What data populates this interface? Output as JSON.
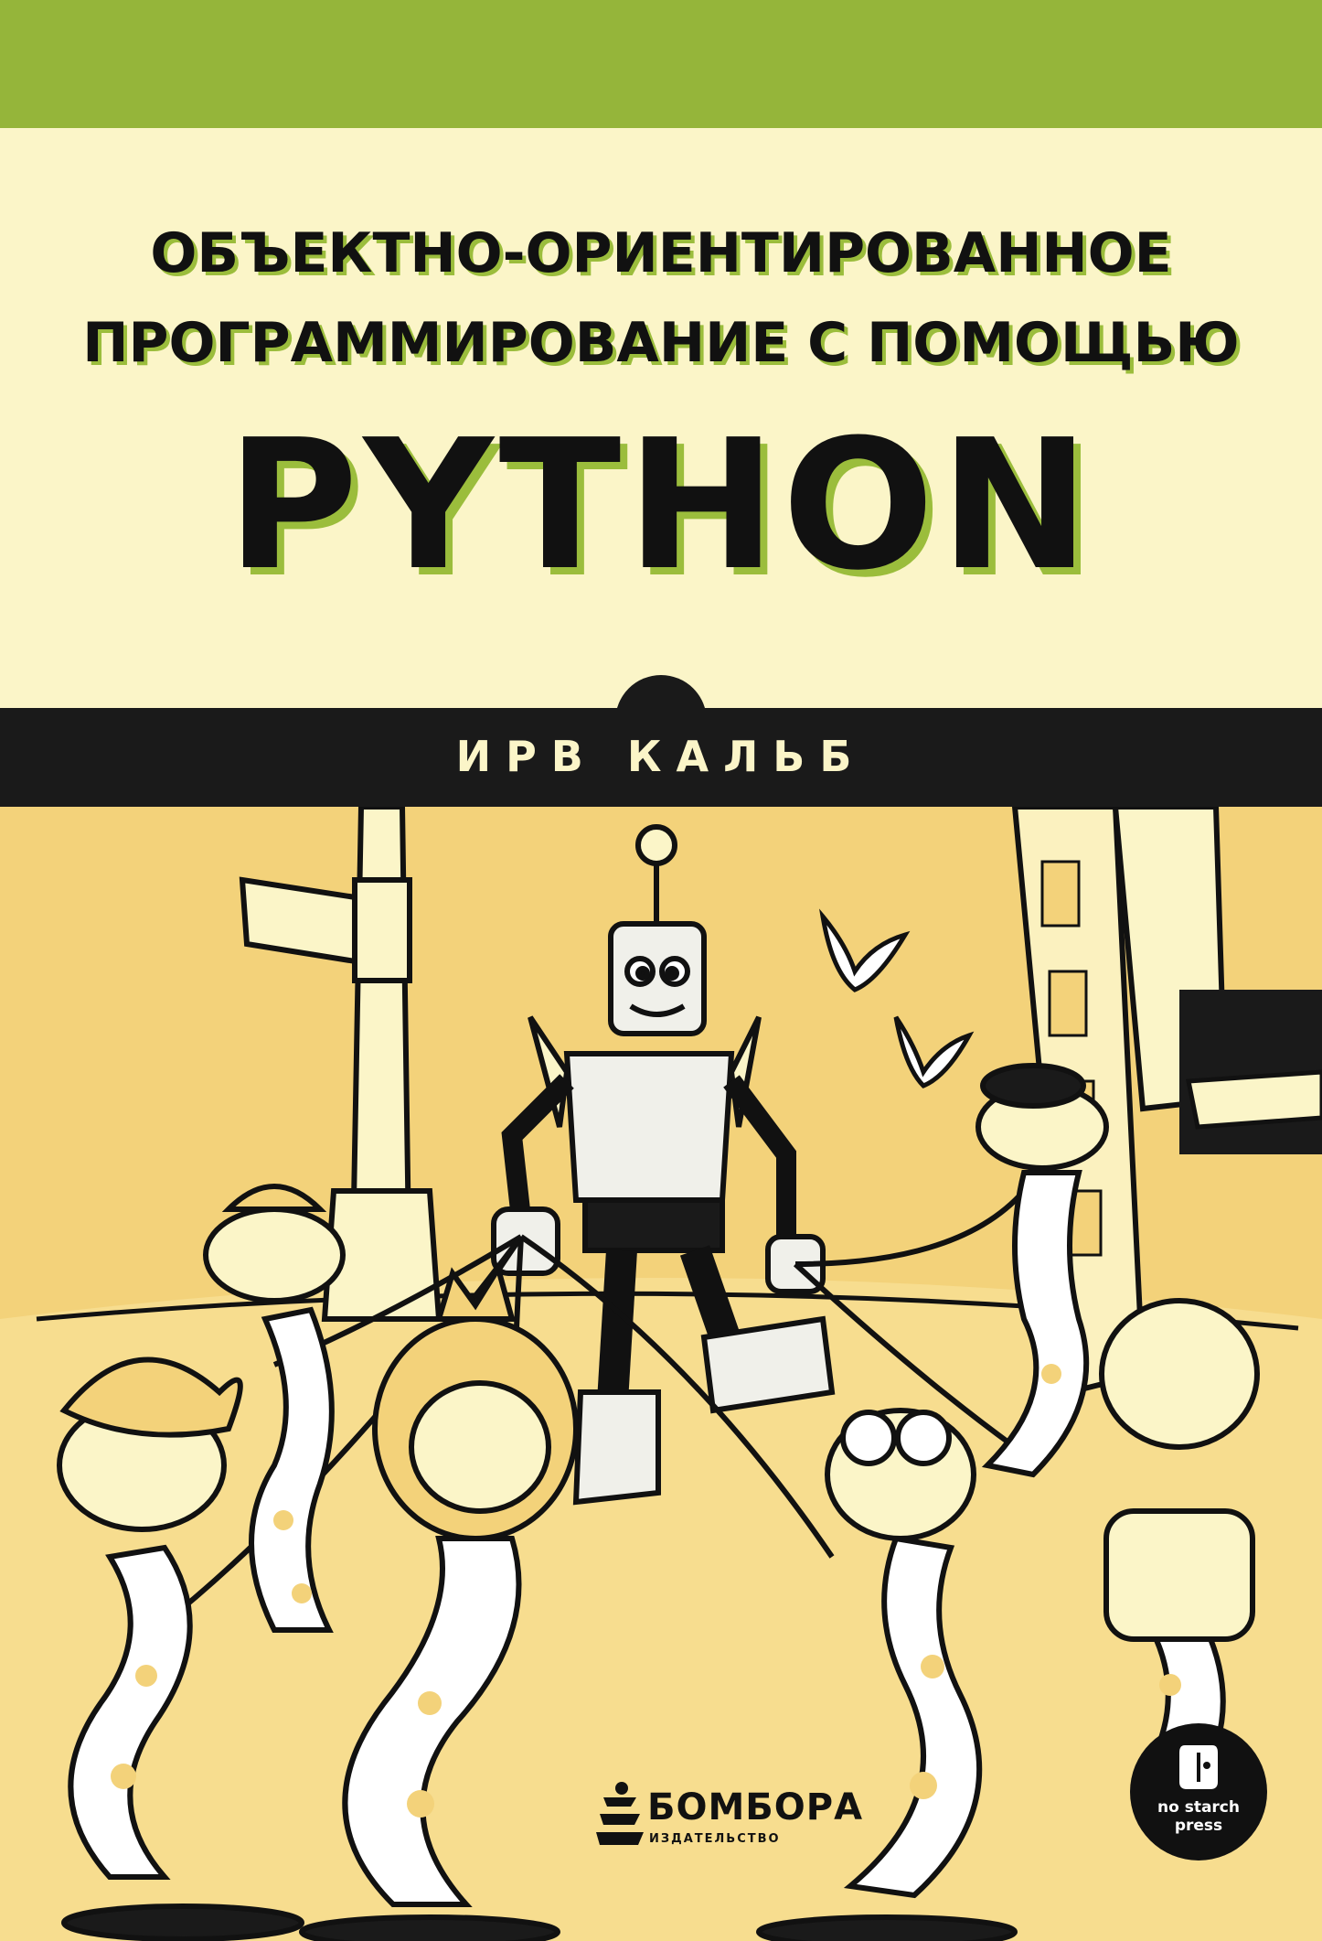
{
  "cover": {
    "subtitle_line1": "ОБЪЕКТНО-ОРИЕНТИРОВАННОЕ",
    "subtitle_line2": "ПРОГРАММИРОВАНИЕ С ПОМОЩЬЮ",
    "title": "PYTHON",
    "author": "ИРВ КАЛЬБ"
  },
  "publisher": {
    "name": "БОМБОРА",
    "subtitle": "ИЗДАТЕЛЬСТВО",
    "icon": "bombora-logo-icon"
  },
  "imprint": {
    "line1": "no starch",
    "line2": "press",
    "icon": "no-starch-logo-icon"
  },
  "colors": {
    "top_band": "#95b53a",
    "title_panel": "#fbf5c8",
    "title_shadow": "#9bbd3c",
    "author_band": "#1a1a1a",
    "illustration_bg": "#f3d27a",
    "ink": "#111111"
  },
  "illustration": {
    "subject": "robot-walking-snakes-illustration"
  }
}
